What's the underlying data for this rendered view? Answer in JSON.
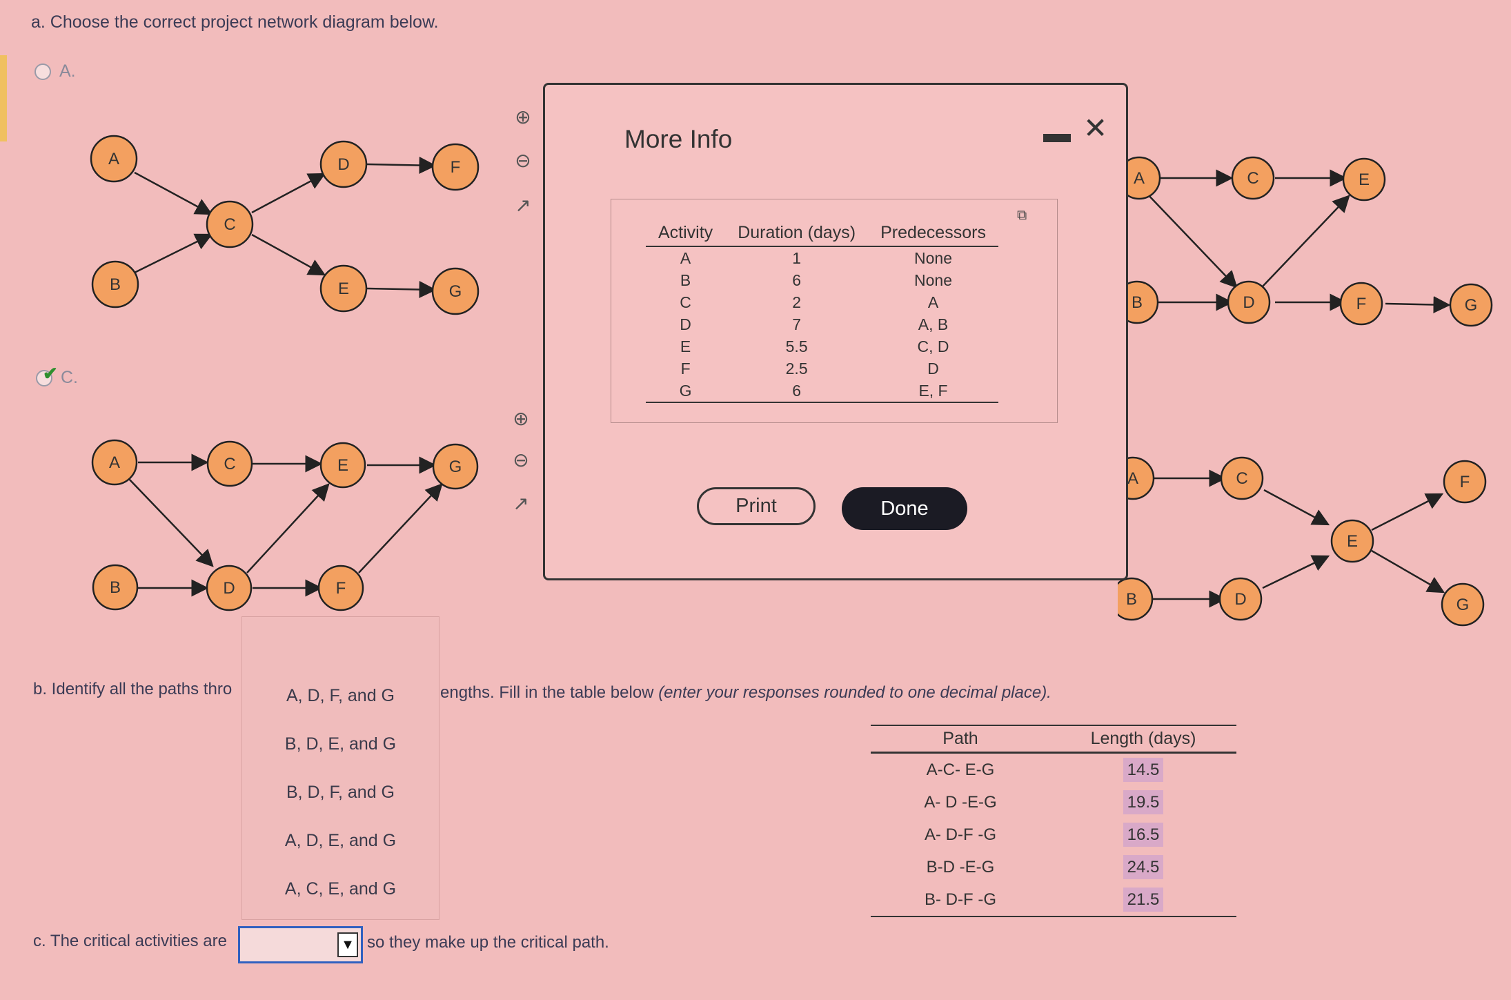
{
  "question_a": {
    "text": "a. Choose the correct project network diagram below.",
    "option_a_label": "A.",
    "option_c_label": "C."
  },
  "diagrams": {
    "nodes": [
      "A",
      "B",
      "C",
      "D",
      "E",
      "F",
      "G"
    ]
  },
  "modal": {
    "title": "More Info",
    "minimize_icon": "minimize-icon",
    "close_icon": "close-icon",
    "headers": [
      "Activity",
      "Duration (days)",
      "Predecessors"
    ],
    "rows": [
      {
        "activity": "A",
        "duration": "1",
        "predecessors": "None"
      },
      {
        "activity": "B",
        "duration": "6",
        "predecessors": "None"
      },
      {
        "activity": "C",
        "duration": "2",
        "predecessors": "A"
      },
      {
        "activity": "D",
        "duration": "7",
        "predecessors": "A, B"
      },
      {
        "activity": "E",
        "duration": "5.5",
        "predecessors": "C, D"
      },
      {
        "activity": "F",
        "duration": "2.5",
        "predecessors": "D"
      },
      {
        "activity": "G",
        "duration": "6",
        "predecessors": "E, F"
      }
    ],
    "print_label": "Print",
    "done_label": "Done"
  },
  "question_b": {
    "text_left": "b. Identify all the paths thro",
    "text_right": "engths. Fill in the table below ",
    "text_hint": "(enter your responses rounded to one decimal place).",
    "dropdown_options": [
      "A, D, F, and G",
      "B, D, E, and G",
      "B, D, F, and G",
      "A, D, E, and G",
      "A, C, E, and G"
    ],
    "table_headers": [
      "Path",
      "Length (days)"
    ],
    "paths": [
      {
        "path": "A-C- E-G",
        "length": "14.5"
      },
      {
        "path": "A- D    -E-G",
        "length": "19.5"
      },
      {
        "path": "A- D-F      -G",
        "length": "16.5"
      },
      {
        "path": "B-D -E-G",
        "length": "24.5"
      },
      {
        "path": "B- D-F  -G",
        "length": "21.5"
      }
    ]
  },
  "question_c": {
    "text_left": "c. The critical activities are",
    "text_right": "so they make up the critical path.",
    "selected_value": ""
  }
}
